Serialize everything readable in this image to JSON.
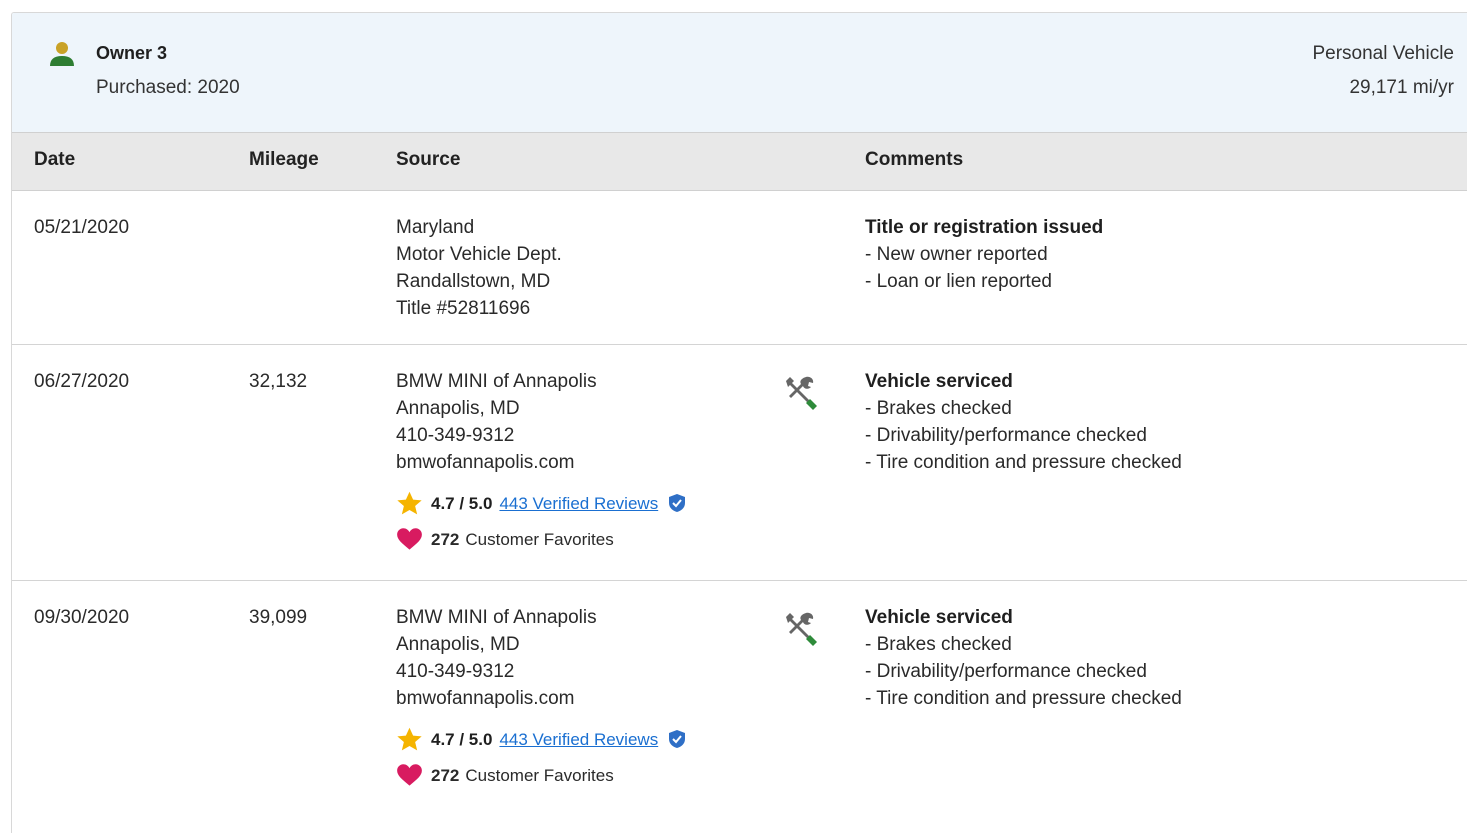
{
  "owner": {
    "title": "Owner 3",
    "purchased": "Purchased: 2020",
    "usage_type": "Personal Vehicle",
    "usage_miles": "29,171 mi/yr",
    "icon": "person-icon",
    "icon_color": "#2e7d32",
    "icon_head_color": "#c9a227"
  },
  "columns": {
    "date": "Date",
    "mileage": "Mileage",
    "source": "Source",
    "comments": "Comments"
  },
  "records": [
    {
      "date": "05/21/2020",
      "mileage": "",
      "source": [
        "Maryland",
        "Motor Vehicle Dept.",
        "Randallstown, MD",
        "Title #52811696"
      ],
      "comment_title": "Title or registration issued",
      "comments": [
        "- New owner reported",
        "- Loan or lien reported"
      ]
    },
    {
      "date": "06/27/2020",
      "mileage": "32,132",
      "source": [
        "BMW MINI of Annapolis",
        "Annapolis, MD",
        "410-349-9312",
        "bmwofannapolis.com"
      ],
      "rating": "4.7 / 5.0",
      "reviews_link": "443 Verified Reviews",
      "favorites_count": "272",
      "favorites_label": "Customer Favorites",
      "service_icon": "wrench-screwdriver-icon",
      "comment_title": "Vehicle serviced",
      "comments": [
        "- Brakes checked",
        "- Drivability/performance checked",
        "- Tire condition and pressure checked"
      ]
    },
    {
      "date": "09/30/2020",
      "mileage": "39,099",
      "source": [
        "BMW MINI of Annapolis",
        "Annapolis, MD",
        "410-349-9312",
        "bmwofannapolis.com"
      ],
      "rating": "4.7 / 5.0",
      "reviews_link": "443 Verified Reviews",
      "favorites_count": "272",
      "favorites_label": "Customer Favorites",
      "service_icon": "wrench-screwdriver-icon",
      "comment_title": "Vehicle serviced",
      "comments": [
        "- Brakes checked",
        "- Drivability/performance checked",
        "- Tire condition and pressure checked"
      ]
    }
  ],
  "colors": {
    "header_bg": "#eef5fb",
    "column_header_bg": "#e8e8e8",
    "link": "#1a6fd1",
    "star": "#f5b400",
    "heart": "#d81b60",
    "shield": "#2f6fc6",
    "service_green": "#2e8b3a",
    "service_gray": "#666666"
  }
}
